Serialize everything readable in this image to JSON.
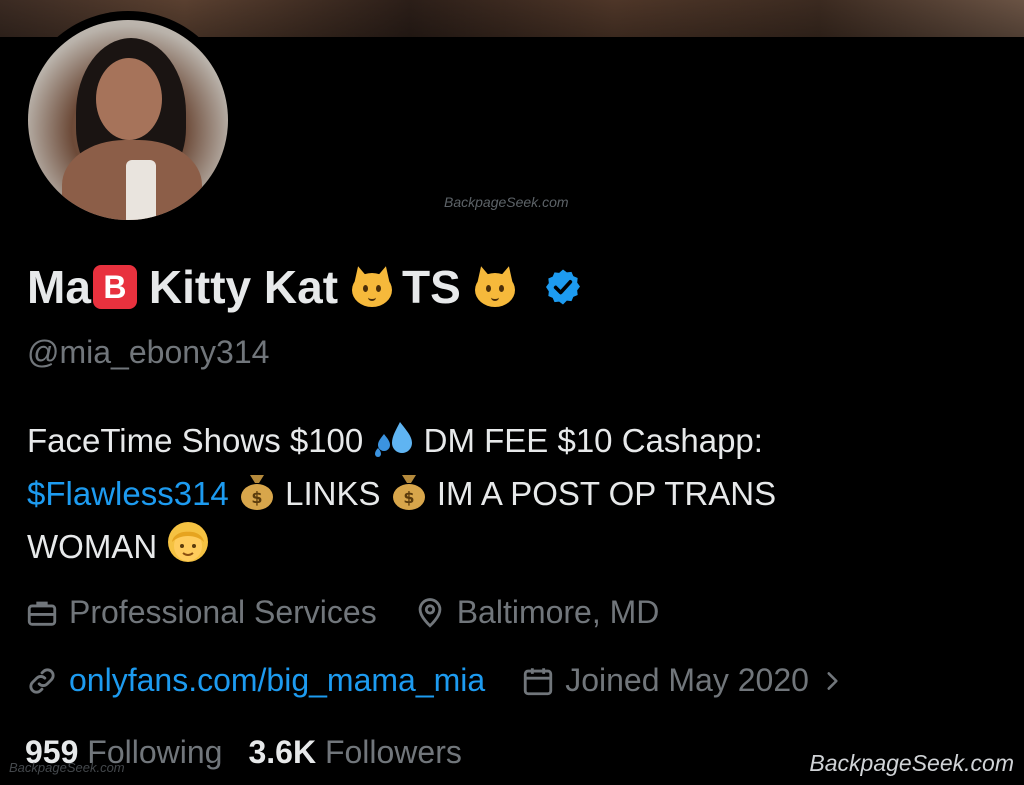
{
  "profile": {
    "display_name_part1": "Ma",
    "display_name_badge_letter": "B",
    "display_name_part2": "Kitty Kat",
    "display_name_part3": "TS",
    "handle": "@mia_ebony314",
    "bio": {
      "line1": "FaceTime Shows $100",
      "line1b": "DM FEE $10 Cashapp:",
      "cashtag": "$Flawless314",
      "links_label": "LINKS",
      "post_text": "IM A POST OP TRANS",
      "line3": "WOMAN"
    },
    "category": "Professional Services",
    "location": "Baltimore, MD",
    "website": "onlyfans.com/big_mama_mia",
    "joined": "Joined May 2020",
    "following_count": "959",
    "following_label": "Following",
    "followers_count": "3.6K",
    "followers_label": "Followers"
  },
  "watermarks": {
    "center": "BackpageSeek.com",
    "corner": "BackpageSeek.com",
    "small": "BackpageSeek.com"
  },
  "colors": {
    "background": "#000000",
    "primary_text": "#e7e9ea",
    "secondary_text": "#71767b",
    "link": "#1d9bf0",
    "verified": "#1d9bf0"
  },
  "icons": [
    "verified-badge-icon",
    "briefcase-icon",
    "location-pin-icon",
    "link-icon",
    "calendar-icon",
    "chevron-right-icon"
  ]
}
